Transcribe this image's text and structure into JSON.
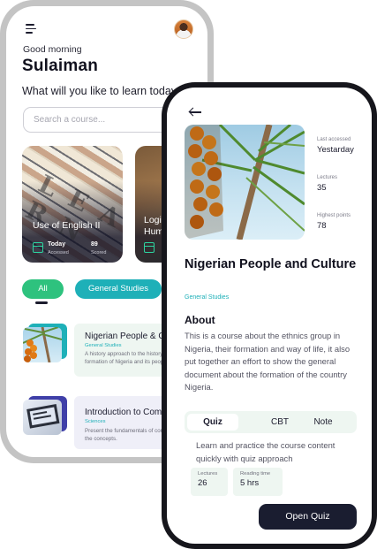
{
  "home": {
    "greeting": "Good morning",
    "username": "Sulaiman",
    "question": "What will you like to learn today?",
    "search_placeholder": "Search a course...",
    "cards": [
      {
        "title": "Use of English II",
        "today_value": "Today",
        "today_label": "Accessed",
        "score_value": "89",
        "score_label": "Scored"
      },
      {
        "title": "Logic & Human",
        "today_value": "",
        "today_label": "",
        "score_value": "",
        "score_label": ""
      }
    ],
    "filters": [
      "All",
      "General Studies"
    ],
    "courses": [
      {
        "title": "Nigerian People & Culture",
        "category": "General Studies",
        "description": "A history approach to the history of Nigeria and the formation of Nigeria and its people."
      },
      {
        "title": "Introduction to Computing",
        "category": "Sciences",
        "description": "Present the fundamentals of computing and introduce the concepts."
      }
    ]
  },
  "detail": {
    "stats": [
      {
        "label": "Last accessed",
        "value": "Yestarday"
      },
      {
        "label": "Lectures",
        "value": "35"
      },
      {
        "label": "Highest points",
        "value": "78"
      }
    ],
    "title": "Nigerian People and Culture",
    "category": "General Studies",
    "about_heading": "About",
    "about_text": "This is a course about the ethnics group in Nigeria, their formation and way of life, it also put together an effort to show the general document about the formation of the country Nigeria.",
    "tabs": [
      "Quiz",
      "CBT",
      "Note"
    ],
    "quiz_description": "Learn and practice the course content quickly with quiz approach",
    "info": [
      {
        "label": "Lectures",
        "value": "26"
      },
      {
        "label": "Reading time",
        "value": "5 hrs"
      }
    ],
    "open_button": "Open Quiz"
  },
  "colors": {
    "accent_green": "#2ec27e",
    "accent_teal": "#1eb0b8",
    "dark_button": "#1a1d30"
  }
}
